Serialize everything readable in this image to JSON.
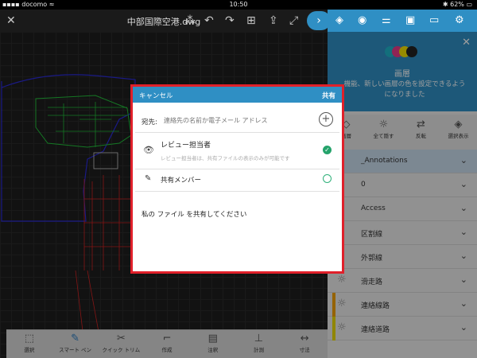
{
  "status_bar": {
    "carrier": "docomo",
    "time": "10:50",
    "battery": "62%"
  },
  "toolbar": {
    "file_name": "中部国際空港.dwg"
  },
  "bottom_tools": [
    {
      "label": "選択"
    },
    {
      "label": "スマート ペン"
    },
    {
      "label": "クイック トリム"
    },
    {
      "label": "作成"
    },
    {
      "label": "注釈"
    },
    {
      "label": "計測"
    },
    {
      "label": "寸法"
    }
  ],
  "layers_panel": {
    "title": "画層",
    "description": "機能、新しい画層の色を設定できるようになりました",
    "actions": [
      {
        "label": "画層"
      },
      {
        "label": "全て隠す"
      },
      {
        "label": "反転"
      },
      {
        "label": "選択表示"
      }
    ],
    "layers": [
      {
        "name": "_Annotations",
        "color": ""
      },
      {
        "name": "0",
        "color": ""
      },
      {
        "name": "Access",
        "color": ""
      },
      {
        "name": "区割線",
        "color": ""
      },
      {
        "name": "外郭線",
        "color": ""
      },
      {
        "name": "滑走路",
        "color": ""
      },
      {
        "name": "連絡線路",
        "color": "#f0a000"
      },
      {
        "name": "連絡道路",
        "color": "#e8d800"
      }
    ]
  },
  "share_dialog": {
    "cancel_label": "キャンセル",
    "share_label": "共有",
    "to_label": "宛先:",
    "to_placeholder": "連絡先の名前か電子メール アドレス",
    "reviewer_title": "レビュー担当者",
    "reviewer_subtitle": "レビュー担当者は、共有ファイルの表示のみが可能です",
    "member_label": "共有メンバー",
    "message": "私の ファイル を共有してください"
  },
  "colors": {
    "accent": "#2f8fc4",
    "highlight_border": "#e0202a"
  }
}
